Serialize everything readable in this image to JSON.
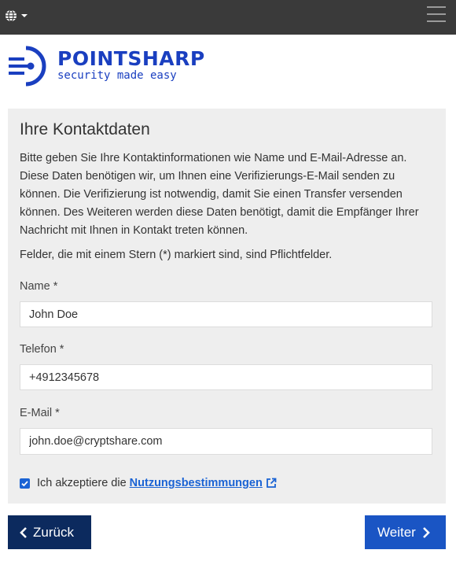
{
  "header": {
    "language_icon": "globe-icon",
    "menu_icon": "hamburger-menu-icon"
  },
  "logo": {
    "title": "POINTSHARP",
    "subtitle": "security made easy",
    "brand_color": "#1a3fc0"
  },
  "form": {
    "title": "Ihre Kontaktdaten",
    "intro": "Bitte geben Sie Ihre Kontaktinformationen wie Name und E-Mail-Adresse an. Diese Daten benötigen wir, um Ihnen eine Verifizierungs-E-Mail senden zu können. Die Verifizierung ist notwendig, damit Sie einen Transfer versenden können. Des Weiteren werden diese Daten benötigt, damit die Empfänger Ihrer Nachricht mit Ihnen in Kontakt treten können.",
    "required_note": "Felder, die mit einem Stern (*) markiert sind, sind Pflichtfelder.",
    "name_label": "Name *",
    "name_value": "John Doe",
    "phone_label": "Telefon *",
    "phone_value": "+4912345678",
    "email_label": "E-Mail *",
    "email_value": "john.doe@cryptshare.com",
    "terms_prefix": "Ich akzeptiere die",
    "terms_link": "Nutzungsbestimmungen",
    "terms_checked": true
  },
  "buttons": {
    "back": "Zurück",
    "next": "Weiter"
  },
  "colors": {
    "topbar": "#3a3a3a",
    "accent": "#1a63d4",
    "back_button": "#0c2a5e",
    "next_button": "#1a55c4"
  }
}
